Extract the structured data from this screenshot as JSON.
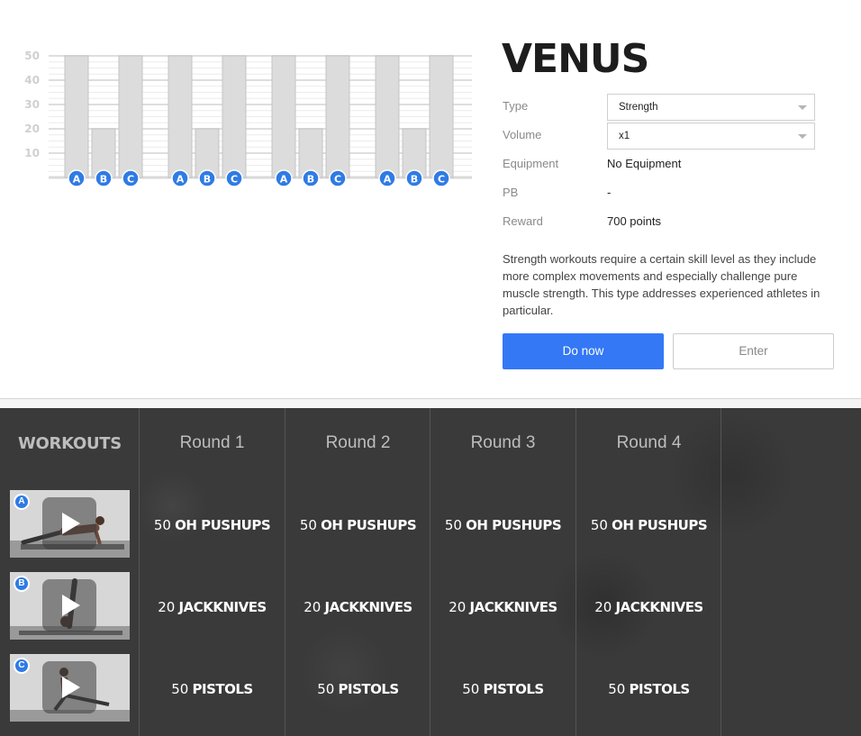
{
  "chart_data": {
    "type": "bar",
    "ylim": [
      0,
      50
    ],
    "yticks": [
      10,
      20,
      30,
      40,
      50
    ],
    "grid": true,
    "groups": [
      {
        "bars": [
          {
            "label": "A",
            "value": 50
          },
          {
            "label": "B",
            "value": 20
          },
          {
            "label": "C",
            "value": 50
          }
        ]
      },
      {
        "bars": [
          {
            "label": "A",
            "value": 50
          },
          {
            "label": "B",
            "value": 20
          },
          {
            "label": "C",
            "value": 50
          }
        ]
      },
      {
        "bars": [
          {
            "label": "A",
            "value": 50
          },
          {
            "label": "B",
            "value": 20
          },
          {
            "label": "C",
            "value": 50
          }
        ]
      },
      {
        "bars": [
          {
            "label": "A",
            "value": 50
          },
          {
            "label": "B",
            "value": 20
          },
          {
            "label": "C",
            "value": 50
          }
        ]
      }
    ],
    "colors": {
      "bar": "#dcdcdc",
      "badge": "#2f7be5"
    }
  },
  "workout": {
    "title": "VENUS",
    "properties": [
      {
        "label": "Type",
        "value": "Strength"
      },
      {
        "label": "Volume",
        "value": "x1"
      },
      {
        "label": "Equipment",
        "value": "No Equipment"
      },
      {
        "label": "PB",
        "value": "-"
      },
      {
        "label": "Reward",
        "value": "700 points"
      }
    ],
    "description": "Strength workouts require a certain skill level as they include more complex movements and especially challenge pure muscle strength. This type addresses experienced athletes in particular.",
    "do_now_label": "Do now",
    "enter_label": "Enter"
  },
  "schedule": {
    "heading": "WORKOUTS",
    "rounds": [
      "Round 1",
      "Round 2",
      "Round 3",
      "Round 4"
    ],
    "exercises": [
      {
        "badge": "A",
        "reps": "50",
        "name": "OH PUSHUPS"
      },
      {
        "badge": "B",
        "reps": "20",
        "name": "JACKKNIVES"
      },
      {
        "badge": "C",
        "reps": "50",
        "name": "PISTOLS"
      }
    ]
  },
  "colors": {
    "accent": "#3478f6",
    "panel_bg": "#3a3a3a"
  }
}
